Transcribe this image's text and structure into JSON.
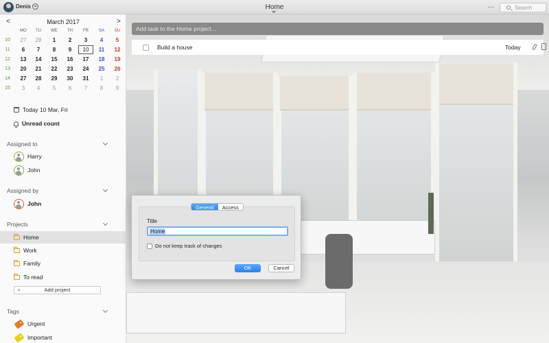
{
  "titlebar": {
    "user": "Denis",
    "title": "Home",
    "more": "...",
    "search_placeholder": "Search"
  },
  "calendar": {
    "prev": "<",
    "next": ">",
    "month": "March 2017",
    "dow": [
      "MO",
      "TU",
      "WE",
      "TH",
      "FR",
      "SA",
      "SU"
    ],
    "weeks": [
      {
        "num": "10",
        "days": [
          "27",
          "28",
          "1",
          "2",
          "3",
          "4",
          "5"
        ]
      },
      {
        "num": "11",
        "days": [
          "6",
          "7",
          "8",
          "9",
          "10",
          "11",
          "12"
        ]
      },
      {
        "num": "12",
        "days": [
          "13",
          "14",
          "15",
          "16",
          "17",
          "18",
          "19"
        ]
      },
      {
        "num": "13",
        "days": [
          "20",
          "21",
          "22",
          "23",
          "24",
          "25",
          "26"
        ]
      },
      {
        "num": "14",
        "days": [
          "27",
          "28",
          "29",
          "30",
          "31",
          "1",
          "2"
        ]
      },
      {
        "num": "15",
        "days": [
          "3",
          "4",
          "5",
          "6",
          "7",
          "8",
          "9"
        ]
      }
    ],
    "selected": "10"
  },
  "sidebar": {
    "today": "Today 10 Mar, Fri",
    "unread": "Unread count",
    "assigned_to": {
      "title": "Assigned to",
      "people": [
        "Harry",
        "John"
      ]
    },
    "assigned_by": {
      "title": "Assigned by",
      "people": [
        "John"
      ]
    },
    "projects": {
      "title": "Projects",
      "items": [
        "Home",
        "Work",
        "Family",
        "To read"
      ],
      "add": "Add project",
      "active": "Home"
    },
    "tags": {
      "title": "Tags",
      "items": [
        {
          "label": "Urgent",
          "color": "#e8772e"
        },
        {
          "label": "Important",
          "color": "#e6d21a"
        }
      ]
    }
  },
  "main": {
    "add_task_placeholder": "Add task to the Home project...",
    "tasks": [
      {
        "name": "Build a house",
        "due": "Today"
      }
    ]
  },
  "dialog": {
    "tabs": [
      "General",
      "Access"
    ],
    "active_tab": "General",
    "title_label": "Title",
    "title_value": "Home",
    "checkbox_label": "Do not keep track of changes",
    "ok": "OK",
    "cancel": "Cancel"
  },
  "colors": {
    "accent": "#2c81ea",
    "week_numbers": "#5a9a2f",
    "saturday": "#3a52b5",
    "sunday": "#c0392b",
    "folder": "#e39a2a"
  }
}
